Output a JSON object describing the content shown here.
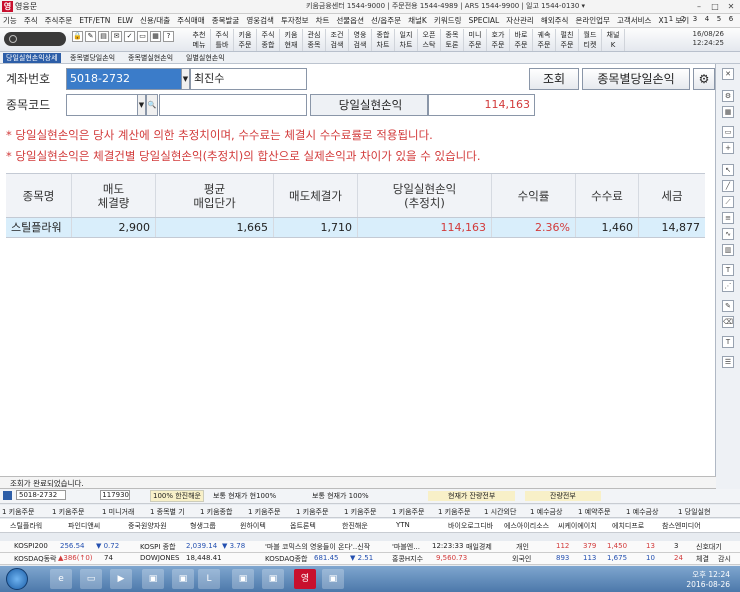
{
  "window": {
    "logo_text": "영",
    "title": "영웅문",
    "center_info": "키움금융센터 1544-9000  |  주문전용 1544-4989  |  ARS 1544-9900  |  일고 1544-0130   ▾"
  },
  "menu": [
    "기능",
    "주식",
    "주식주문",
    "ETF/ETN",
    "ELW",
    "신용/대출",
    "주식매매",
    "종목발굴",
    "영웅검색",
    "투자정보",
    "차트",
    "선물옵션",
    "선/옵주문",
    "채널K",
    "키워드링",
    "SPECIAL",
    "자산관리",
    "해외주식",
    "온라인업무",
    "고객서비스",
    "X1",
    "보기"
  ],
  "menu_numbers": [
    "1",
    "2",
    "3",
    "4",
    "5",
    "6"
  ],
  "toolbar": {
    "buttons": [
      "추천\n메뉴",
      "주식\n틀바",
      "키움\n주문",
      "주식\n종합",
      "키움\n현재",
      "관심\n종목",
      "조건\n검색",
      "영웅\n검색",
      "종합\n차트",
      "일지\n차트",
      "오픈\n스탁",
      "종목\n토론",
      "미니\n주문",
      "호가\n주문",
      "바로\n주문",
      "궤속\n주문",
      "펄친\n주문",
      "월드\n티켓",
      "채널\nK"
    ],
    "date": "16/08/26",
    "time": "12:24:25"
  },
  "subtabs": [
    "당일실현손익상세",
    "종목별당일손익",
    "종목별실현손익",
    "일별실현손익"
  ],
  "form": {
    "account_label": "계좌번호",
    "account_value": "5018-2732",
    "owner": "최진수",
    "stock_label": "종목코드",
    "stock_value": "",
    "stock_name": "",
    "lookup_button": "조회",
    "by_stock_button": "종목별당일손익",
    "realized_label": "당일실현손익",
    "realized_value": "114,163"
  },
  "notes": [
    "* 당일실현손익은 당사 계산에 의한 추정치이며, 수수료는 체결시 수수료률로 적용됩니다.",
    "* 당일실현손익은 체결건별 당일실현손익(추정치)의 합산으로 실제손익과 차이가 있을 수 있습니다."
  ],
  "table": {
    "headers": [
      "종목명",
      "매도\n체결량",
      "평균\n매입단가",
      "매도체결가",
      "당일실현손익\n(추정치)",
      "수익률",
      "수수료",
      "세금"
    ],
    "rows": [
      [
        "스틸플라워",
        "2,900",
        "1,665",
        "1,710",
        "114,163",
        "2.36%",
        "1,460",
        "14,877"
      ]
    ]
  },
  "status_text": "조회가 완료되었습니다.",
  "order_bar": {
    "account": "5018-2732",
    "price": "117930",
    "ratio": "100%",
    "item1": "100% 한진해운",
    "item2": "보통  현재가  현100%",
    "item3": "보통  현재가  100%",
    "item4": "현재가  잔량전부",
    "item5": "잔량전부"
  },
  "shortcuts": [
    "1 키움주문",
    "1 키움주문",
    "1 미니거래",
    "1 종목별 기",
    "1 키움종합",
    "1 키움주문",
    "1 키움주문",
    "1 키움주문",
    "1 키움주문",
    "1 키움주문",
    "1 시간외단",
    "1 예수금상",
    "1 예약주문",
    "1 예수금상",
    "1 당일실현"
  ],
  "watch": [
    "스틸플라워",
    "파인디앤씨",
    "중국원양자원",
    "형생그룹",
    "윈하이텍",
    "옵트론텍",
    "한진해운",
    "YTN",
    "바이오로그디바",
    "에스아이리소스",
    "씨케이에이치",
    "에치디프로",
    "참스엔미디어"
  ],
  "ticker1": {
    "a": "KOSPI200",
    "b": "256.54",
    "c": "▼ 0.72",
    "d": "KOSPI 종합",
    "e": "2,039.14",
    "f": "▼ 3.78",
    "g": "'마블 코믹스의 영웅들이 온다'..신작",
    "h": "'마블엔...",
    "i": "12:23:33",
    "j": "매일경제",
    "k": "개인",
    "l": "112",
    "m": "379",
    "n": "1,450",
    "o": "13",
    "p": "3",
    "q": "신호대기"
  },
  "ticker2": {
    "a": "KOSDAQ동락",
    "b": "▲386(↑0)",
    "c": "74",
    "d": "DOWJONES",
    "e": "18,448.41",
    "f": "KOSDAQ종합",
    "g": "681.45",
    "h": "▼ 2.51",
    "i": "홍콩H지수",
    "j": "9,560.73",
    "k": "외국인",
    "l": "893",
    "m": "113",
    "n": "1,675",
    "o": "10",
    "p": "24",
    "q": "체결",
    "r": "감시"
  },
  "ticker3": {
    "k": "기관",
    "l": "816",
    "m": "223",
    "n": "152",
    "o": "3",
    "p": "25"
  },
  "taskbar": {
    "time": "오후 12:24",
    "date": "2016-08-26"
  },
  "colors": {
    "accent": "#2d5ea8",
    "highlight_row": "#d9eefb",
    "note_red": "#d23a3a"
  }
}
